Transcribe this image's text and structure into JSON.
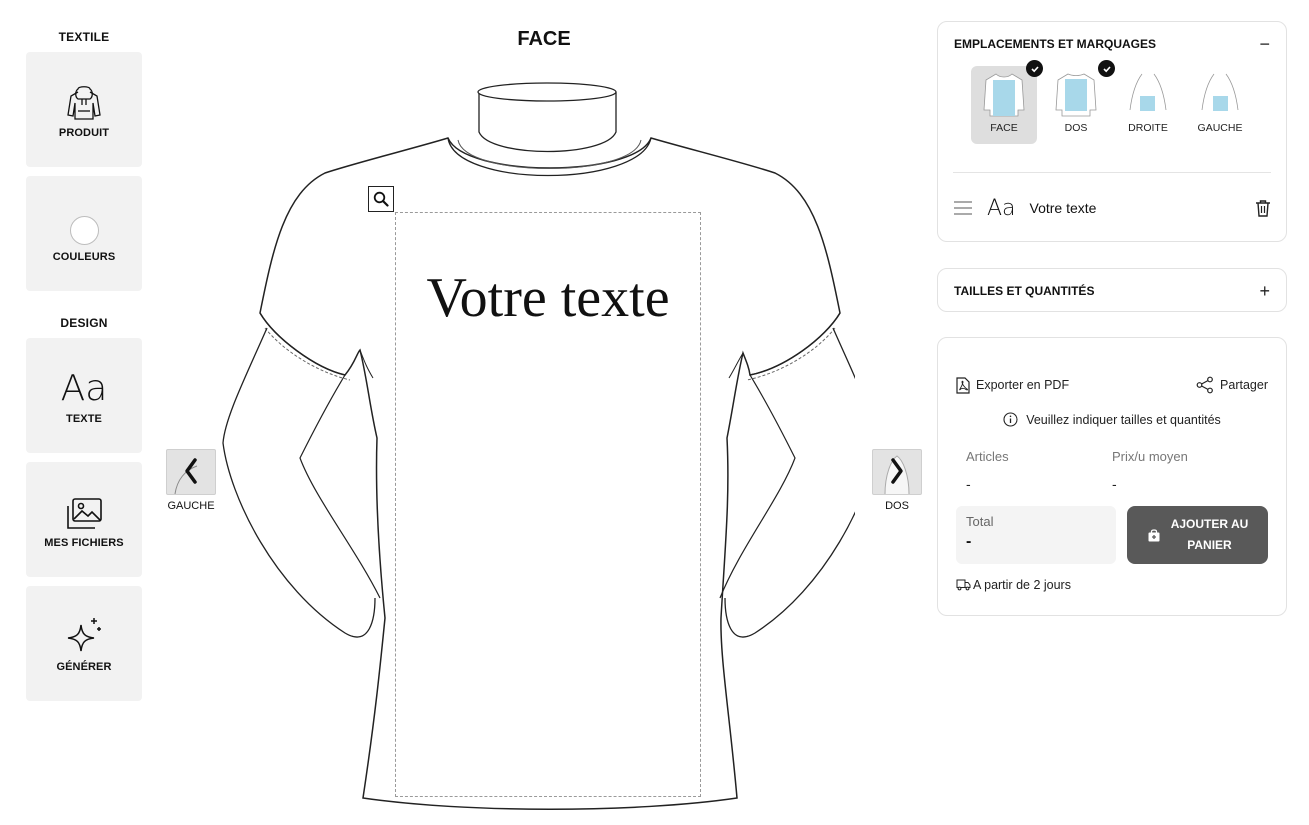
{
  "sidebar": {
    "textile_title": "TEXTILE",
    "design_title": "DESIGN",
    "tools": {
      "product": "PRODUIT",
      "colors": "COULEURS",
      "text": "TEXTE",
      "files": "MES FICHIERS",
      "generate": "GÉNÉRER"
    }
  },
  "canvas": {
    "view_title": "FACE",
    "design_text": "Votre texte",
    "prev_label": "GAUCHE",
    "next_label": "DOS"
  },
  "panel": {
    "placements_title": "EMPLACEMENTS ET MARQUAGES",
    "placements": [
      {
        "label": "FACE",
        "active": true,
        "checked": true
      },
      {
        "label": "DOS",
        "active": false,
        "checked": true
      },
      {
        "label": "DROITE",
        "active": false,
        "checked": false
      },
      {
        "label": "GAUCHE",
        "active": false,
        "checked": false
      }
    ],
    "layer_icon_text": "Aa",
    "layer_text": "Votre texte",
    "sizes_title": "TAILLES ET QUANTITÉS",
    "collapse_symbol": "−",
    "expand_symbol": "+"
  },
  "summary": {
    "export_label": "Exporter en PDF",
    "share_label": "Partager",
    "notice": "Veuillez indiquer tailles et quantités",
    "articles_label": "Articles",
    "articles_value": "-",
    "price_label": "Prix/u moyen",
    "price_value": "-",
    "total_label": "Total",
    "total_value": "-",
    "cart_line1": "AJOUTER AU",
    "cart_line2": "PANIER",
    "delivery": "A partir de 2 jours"
  },
  "colors": {
    "tool_bg": "#f2f2f2",
    "cart_bg": "#595959",
    "placement_fill": "#a8d8ea"
  }
}
